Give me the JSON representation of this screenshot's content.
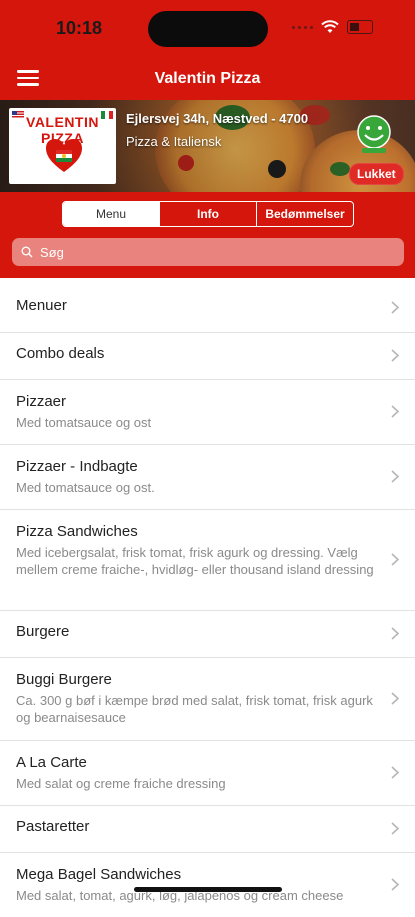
{
  "status_bar": {
    "time": "10:18"
  },
  "nav": {
    "title": "Valentin Pizza"
  },
  "restaurant": {
    "logo_text": "VALENTIN PIZZA",
    "address": "Ejlersvej 34h, Næstved - 4700",
    "cuisine": "Pizza & Italiensk",
    "status_badge": "Lukket"
  },
  "tabs": [
    {
      "label": "Menu",
      "active": true
    },
    {
      "label": "Info",
      "active": false
    },
    {
      "label": "Bedømmelser",
      "active": false
    }
  ],
  "search": {
    "placeholder": "Søg",
    "value": ""
  },
  "menu_categories": [
    {
      "name": "Menuer",
      "description": ""
    },
    {
      "name": "Combo deals",
      "description": ""
    },
    {
      "name": "Pizzaer",
      "description": "Med tomatsauce og ost"
    },
    {
      "name": "Pizzaer - Indbagte",
      "description": "Med tomatsauce og ost."
    },
    {
      "name": "Pizza Sandwiches",
      "description": "Med icebergsalat, frisk tomat, frisk agurk og dressing. Vælg mellem creme fraiche-, hvidløg- eller thousand island dressing"
    },
    {
      "name": "Burgere",
      "description": ""
    },
    {
      "name": "Buggi Burgere",
      "description": "Ca. 300 g bøf i kæmpe brød med salat, frisk tomat, frisk agurk og bearnaisesauce"
    },
    {
      "name": "A La Carte",
      "description": "Med salat og creme fraiche dressing"
    },
    {
      "name": "Pastaretter",
      "description": ""
    },
    {
      "name": "Mega Bagel Sandwiches",
      "description": "Med salat, tomat, agurk, løg, jalapenos og cream cheese"
    }
  ],
  "colors": {
    "brand_red": "#d4160c",
    "search_bg": "#e8837e",
    "badge_red": "#e02a25"
  }
}
